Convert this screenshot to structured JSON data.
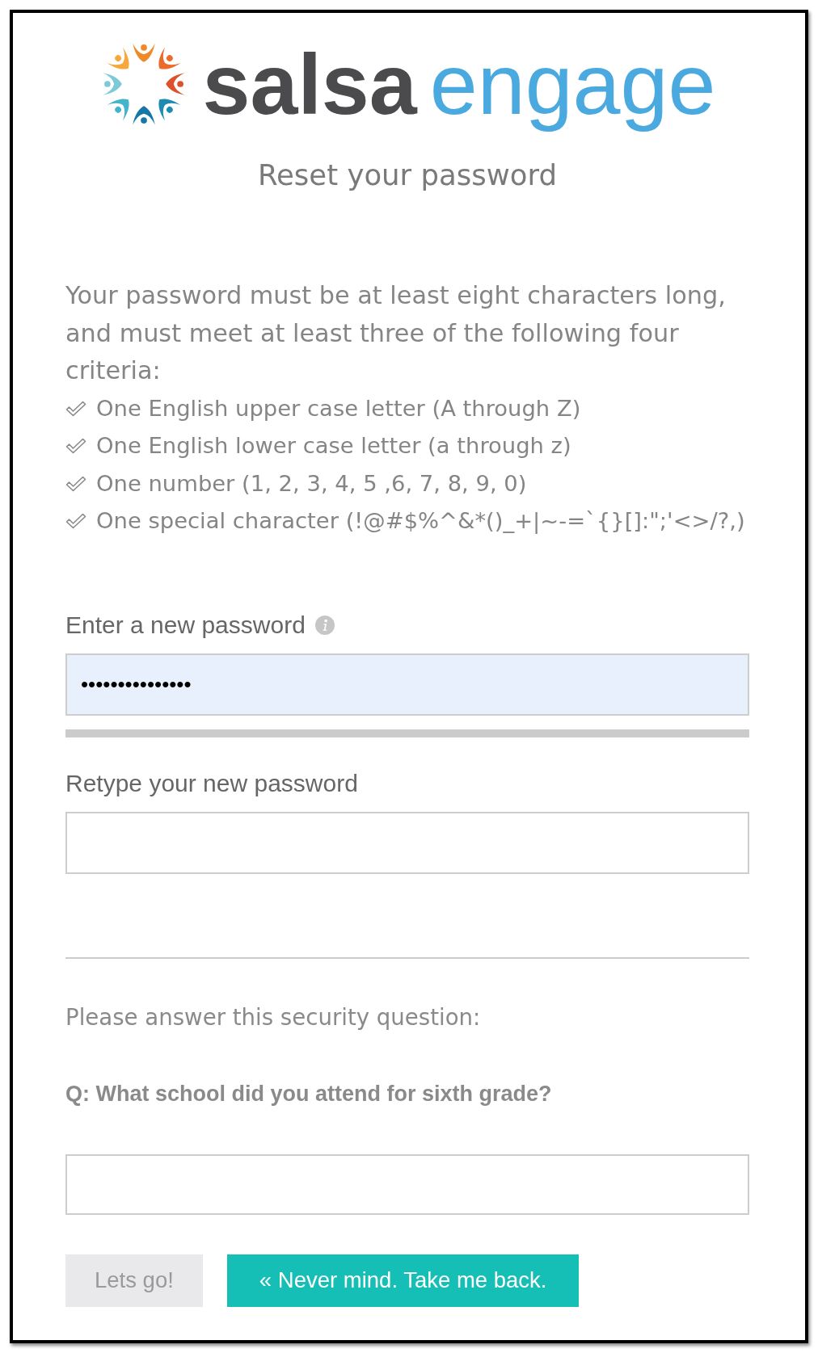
{
  "logo": {
    "words": [
      "salsa",
      "engage"
    ]
  },
  "title": "Reset your password",
  "requirements": {
    "intro": "Your password must be at least eight characters long, and must meet at least three of the following four criteria:",
    "criteria": [
      "One English upper case letter (A through Z)",
      "One English lower case letter (a through z)",
      "One number (1, 2, 3, 4, 5 ,6, 7, 8, 9, 0)",
      "One special character (!@#$%^&*()_+|~-=`{}[]:\";'<>/?,)"
    ]
  },
  "password_fields": [
    {
      "label": "Enter a new password",
      "info_icon": true,
      "value": "•••••••••••••••",
      "autofilled": true,
      "strength_meter": true
    },
    {
      "label": "Retype your new password",
      "info_icon": false,
      "autofilled": false,
      "strength_meter": false
    }
  ],
  "security": {
    "prompt": "Please answer this security question:",
    "question": "Q: What school did you attend for sixth grade?"
  },
  "buttons": [
    {
      "label": "Lets go!",
      "disabled": true
    },
    {
      "label": "« Never mind. Take me back.",
      "disabled": false
    }
  ]
}
